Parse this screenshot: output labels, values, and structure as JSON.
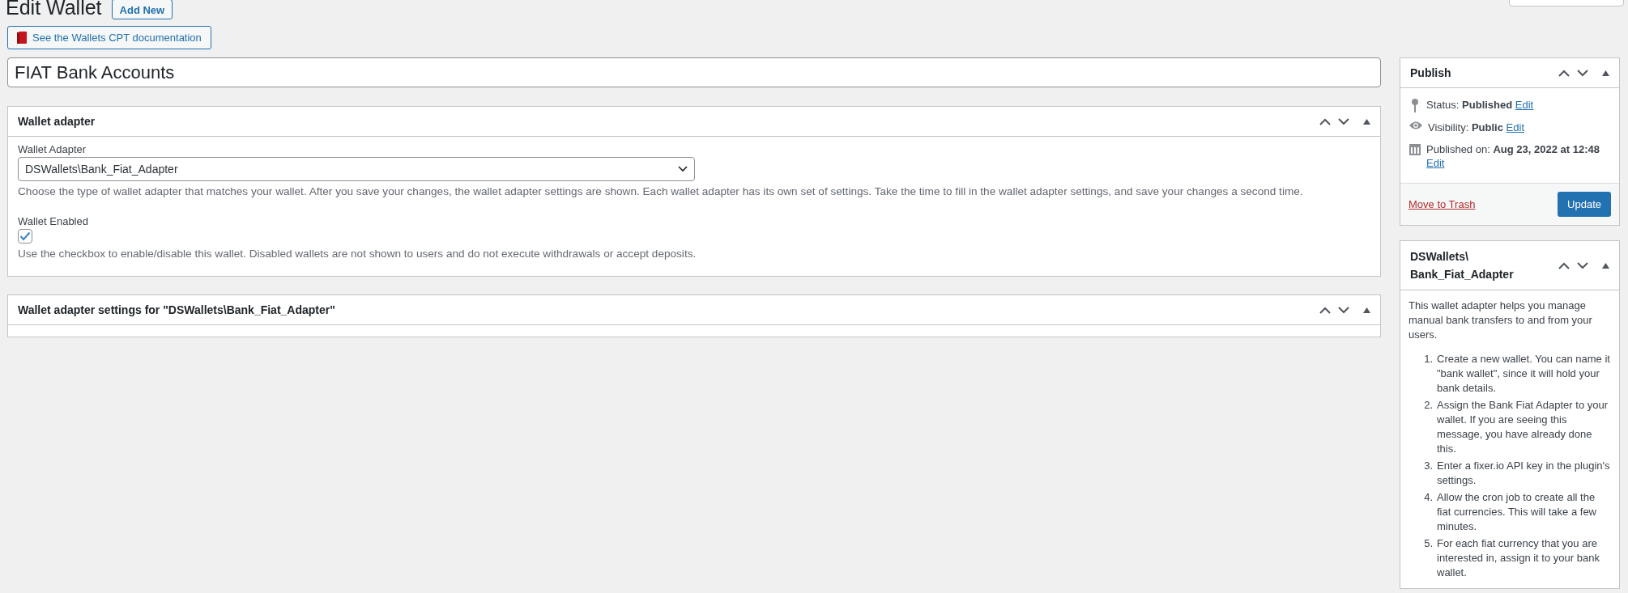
{
  "header": {
    "title": "Edit Wallet",
    "add_new": "Add New",
    "doc_button": "See the Wallets CPT documentation"
  },
  "post_title": {
    "value": "FIAT Bank Accounts"
  },
  "panels": [
    {
      "kind": "adapter",
      "title": "Wallet adapter",
      "select_label": "Wallet Adapter",
      "select_value": "DSWallets\\Bank_Fiat_Adapter",
      "select_help": "Choose the type of wallet adapter that matches your wallet. After you save your changes, the wallet adapter settings are shown. Each wallet adapter has its own set of settings. Take the time to fill in the wallet adapter settings, and save your changes a second time.",
      "checkbox_label": "Wallet Enabled",
      "checked": true,
      "checkbox_help": "Use the checkbox to enable/disable this wallet. Disabled wallets are not shown to users and do not execute withdrawals or accept deposits."
    },
    {
      "kind": "empty",
      "title": "Wallet adapter settings for \"DSWallets\\Bank_Fiat_Adapter\""
    }
  ],
  "publish": {
    "title": "Publish",
    "rows": [
      {
        "kind": "status",
        "label": "Status:",
        "value": "Published",
        "link": "Edit"
      },
      {
        "kind": "visibility",
        "label": "Visibility:",
        "value": "Public",
        "link": "Edit"
      },
      {
        "kind": "date",
        "label": "Published on:",
        "value": "Aug 23, 2022 at 12:48",
        "link": "Edit"
      }
    ],
    "trash": "Move to Trash",
    "update": "Update"
  },
  "adapter_box": {
    "title_lines": [
      "DSWallets\\",
      "Bank_Fiat_Adapter"
    ],
    "intro": "This wallet adapter helps you manage manual bank transfers to and from your users.",
    "steps": [
      "Create a new wallet. You can name it \"bank wallet\", since it will hold your bank details.",
      "Assign the Bank Fiat Adapter to your wallet. If you are seeing this message, you have already done this.",
      "Enter a fixer.io API key in the plugin's settings.",
      "Allow the cron job to create all the fiat currencies. This will take a few minutes.",
      "For each fiat currency that you are interested in, assign it to your bank wallet."
    ],
    "step_numbers": [
      "1.",
      "2.",
      "3.",
      "4.",
      "5."
    ]
  }
}
